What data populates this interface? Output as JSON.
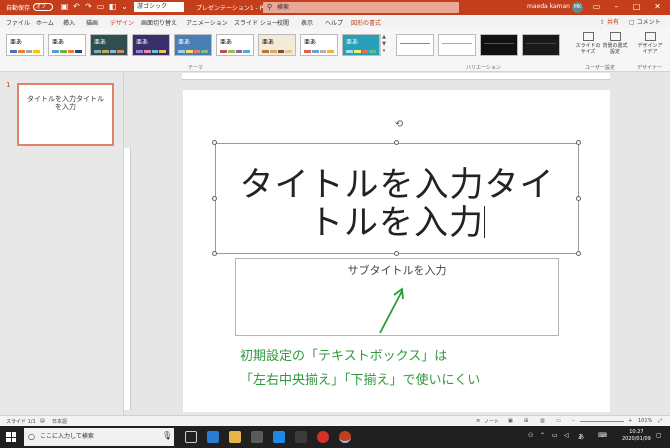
{
  "titlebar": {
    "autosave_label": "自動保存",
    "autosave_state": "オフ",
    "font_value": "游ゴシック",
    "filename": "プレゼンテーション1 - PowerPo",
    "search_placeholder": "検索",
    "user_name": "maeda kaman",
    "avatar_initials": "MK"
  },
  "tabs": [
    {
      "label": "ファイル"
    },
    {
      "label": "ホーム"
    },
    {
      "label": "挿入"
    },
    {
      "label": "描画"
    },
    {
      "label": "デザイン"
    },
    {
      "label": "画面切り替え"
    },
    {
      "label": "アニメーション"
    },
    {
      "label": "スライド ショー"
    },
    {
      "label": "校閲"
    },
    {
      "label": "表示"
    },
    {
      "label": "ヘルプ"
    },
    {
      "label": "図形の書式"
    }
  ],
  "share_label": "共有",
  "comments_label": "コメント",
  "ribbon": {
    "theme_sample": "亜あ",
    "themes_group": "テーマ",
    "variations_group": "バリエーション",
    "user_settings_group": "ユーザー設定",
    "designer_group": "デザイナー",
    "slide_size_label": "スライドのサイズ",
    "format_background_label": "背景の書式設定",
    "design_ideas_label": "デザインアイデア"
  },
  "thumbnail": {
    "number": "1",
    "text": "タイトルを入力タイトルを入力"
  },
  "slide": {
    "title_line1": "タイトルを入力タイ",
    "title_line2": "トルを入力",
    "subtitle": "サブタイトルを入力"
  },
  "annotation": {
    "line1": "初期設定の「テキストボックス」は",
    "line2": "「左右中央揃え」「下揃え」で使いにくい"
  },
  "status": {
    "slide_indicator": "スライド 1/1",
    "language": "日本語",
    "notes_label": "ノート",
    "zoom": "101%"
  },
  "taskbar": {
    "search_placeholder": "ここに入力して検索",
    "ime": "あ",
    "time": "10:27",
    "date": "2020/01/09"
  }
}
